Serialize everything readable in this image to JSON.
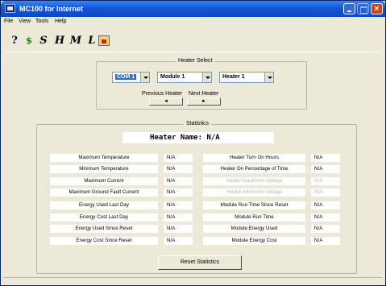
{
  "window": {
    "title": "MC100 for Internet",
    "close_glyph": "×"
  },
  "menu": [
    "File",
    "View",
    "Tools",
    "Help"
  ],
  "toolbar": {
    "tools": [
      {
        "name": "help-icon",
        "glyph": "?"
      },
      {
        "name": "cost-icon",
        "glyph": "$"
      },
      {
        "name": "s-tool-icon",
        "glyph": "S"
      },
      {
        "name": "h-tool-icon",
        "glyph": "H"
      },
      {
        "name": "m-tool-icon",
        "glyph": "M"
      },
      {
        "name": "l-tool-icon",
        "glyph": "L"
      },
      {
        "name": "calendar-icon",
        "glyph": ""
      }
    ]
  },
  "heater_select": {
    "legend": "Heater Select",
    "com_value": "COM 1",
    "module_value": "Module 1",
    "heater_value": "Heater 1",
    "prev_label": "Previous Heater",
    "next_label": "Next Heater",
    "prev_arrow": "◄",
    "next_arrow": "►"
  },
  "statistics": {
    "legend": "Statistics",
    "heater_name": "Heater Name: N/A",
    "left_rows": [
      {
        "label": "Maximum Temperature",
        "value": "N/A"
      },
      {
        "label": "Minimum Temperature",
        "value": "N/A"
      },
      {
        "label": "Maximum Current",
        "value": "N/A"
      },
      {
        "label": "Maximum Ground Fault Current",
        "value": "N/A"
      },
      {
        "label": "Energy Used Last Day",
        "value": "N/A"
      },
      {
        "label": "Energy Cost Last Day",
        "value": "N/A"
      },
      {
        "label": "Energy Used Since Reset",
        "value": "N/A"
      },
      {
        "label": "Energy Cost Since Reset",
        "value": "N/A"
      }
    ],
    "right_rows": [
      {
        "label": "Heater Turn On Hours",
        "value": "N/A"
      },
      {
        "label": "Heater On Percentage of Time",
        "value": "N/A"
      },
      {
        "label": "Heater Maximum Voltage",
        "value": "N/A"
      },
      {
        "label": "Heater Minimum Voltage",
        "value": "N/A"
      },
      {
        "label": "Module Run Time Since Reset",
        "value": "N/A"
      },
      {
        "label": "Module Run Time",
        "value": "N/A"
      },
      {
        "label": "Module Energy Used",
        "value": "N/A"
      },
      {
        "label": "Module Energy Cost",
        "value": "N/A"
      }
    ],
    "reset_label": "Reset Statistics"
  }
}
